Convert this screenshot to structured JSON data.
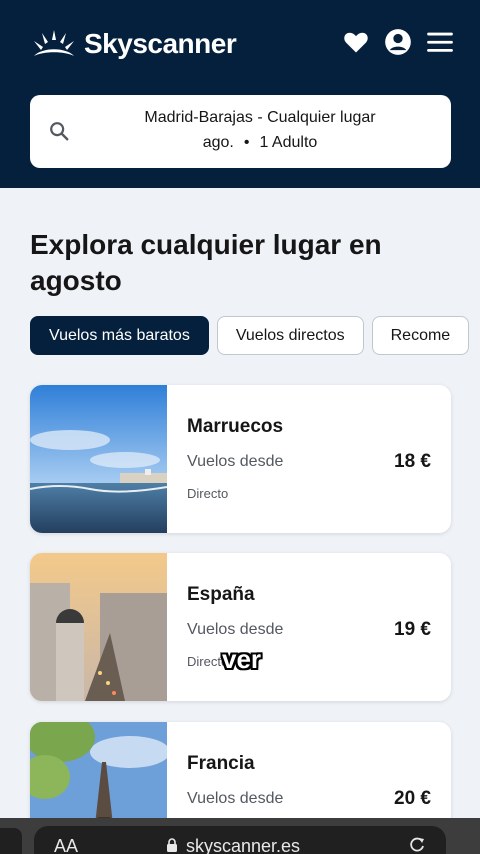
{
  "header": {
    "brand": "Skyscanner",
    "icons": [
      "sunrise-logo-icon",
      "heart-icon",
      "account-icon",
      "menu-icon"
    ],
    "bg_color": "#05203c"
  },
  "search": {
    "route": "Madrid-Barajas - Cualquier lugar",
    "month": "ago.",
    "separator": "•",
    "travellers": "1 Adulto"
  },
  "main": {
    "title": "Explora cualquier lugar en agosto",
    "chips": [
      {
        "label": "Vuelos más baratos",
        "active": true
      },
      {
        "label": "Vuelos directos",
        "active": false
      },
      {
        "label": "Recome",
        "active": false
      }
    ],
    "results": [
      {
        "country": "Marruecos",
        "from_label": "Vuelos desde",
        "price": "18 €",
        "stops": "Directo"
      },
      {
        "country": "España",
        "from_label": "Vuelos desde",
        "price": "19 €",
        "stops": "Directo"
      },
      {
        "country": "Francia",
        "from_label": "Vuelos desde",
        "price": "20 €",
        "stops": ""
      }
    ]
  },
  "caption": "ver",
  "browser": {
    "aa": "AA",
    "url": "skyscanner.es"
  }
}
